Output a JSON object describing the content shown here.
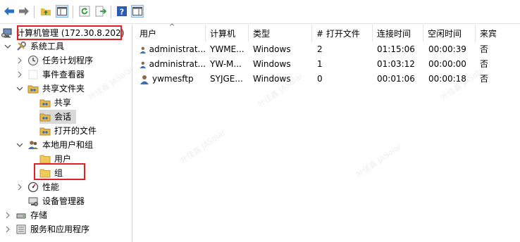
{
  "toolbar": {
    "buttons": [
      {
        "name": "back-arrow-icon"
      },
      {
        "name": "forward-arrow-icon"
      },
      {
        "name": "folder-up-icon"
      },
      {
        "name": "show-hide-console-tree-icon"
      },
      {
        "name": "refresh-icon"
      },
      {
        "name": "export-list-icon"
      },
      {
        "name": "help-icon"
      },
      {
        "name": "show-action-pane-icon"
      }
    ]
  },
  "tree": {
    "root": "计算机管理 (172.30.8.202)",
    "items": [
      {
        "label": "系统工具"
      },
      {
        "label": "任务计划程序"
      },
      {
        "label": "事件查看器"
      },
      {
        "label": "共享文件夹"
      },
      {
        "label": "共享"
      },
      {
        "label": "会话"
      },
      {
        "label": "打开的文件"
      },
      {
        "label": "本地用户和组"
      },
      {
        "label": "用户"
      },
      {
        "label": "组"
      },
      {
        "label": "性能"
      },
      {
        "label": "设备管理器"
      },
      {
        "label": "存储"
      },
      {
        "label": "服务和应用程序"
      }
    ]
  },
  "list": {
    "columns": [
      "用户",
      "计算机",
      "类型",
      "# 打开文件",
      "连接时间",
      "空闲时间",
      "来宾"
    ],
    "rows": [
      {
        "user": "administrat...",
        "computer": "YWME...",
        "type": "Windows",
        "open_files": "2",
        "connected": "01:15:06",
        "idle": "00:00:39",
        "guest": "否"
      },
      {
        "user": "administrat...",
        "computer": "YW-M...",
        "type": "Windows",
        "open_files": "1",
        "connected": "01:03:12",
        "idle": "00:00:00",
        "guest": "否"
      },
      {
        "user": "ywmesftp",
        "computer": "SYJGE...",
        "type": "Windows",
        "open_files": "0",
        "connected": "00:01:06",
        "idle": "00:00:18",
        "guest": "否"
      }
    ]
  },
  "colors": {
    "highlight": "#e01f26",
    "selection": "#d9d9d9",
    "arrow_blue": "#2a6fc9"
  },
  "watermark": "叶佳鑫 JASolar"
}
